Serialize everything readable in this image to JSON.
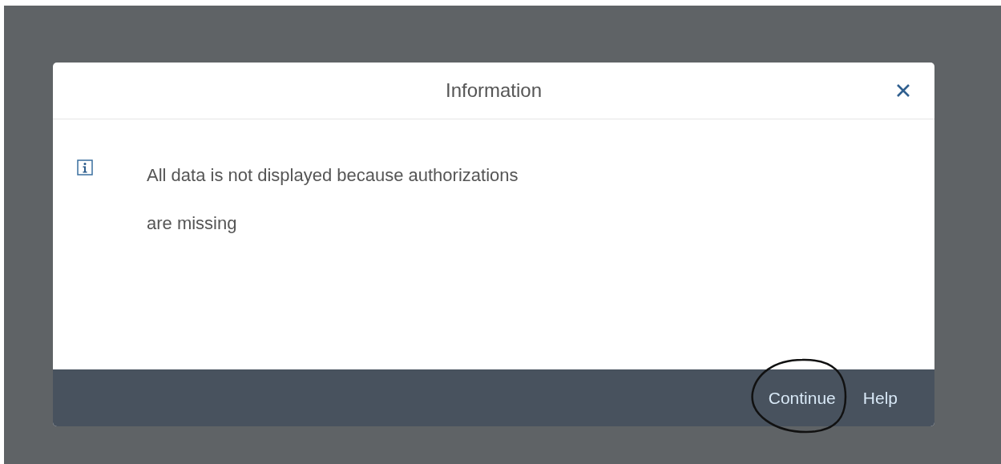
{
  "dialog": {
    "title": "Information",
    "message": "All data is not displayed because authorizations are missing",
    "buttons": [
      {
        "label": "Continue",
        "circled": true
      },
      {
        "label": "Help",
        "circled": false
      }
    ]
  }
}
